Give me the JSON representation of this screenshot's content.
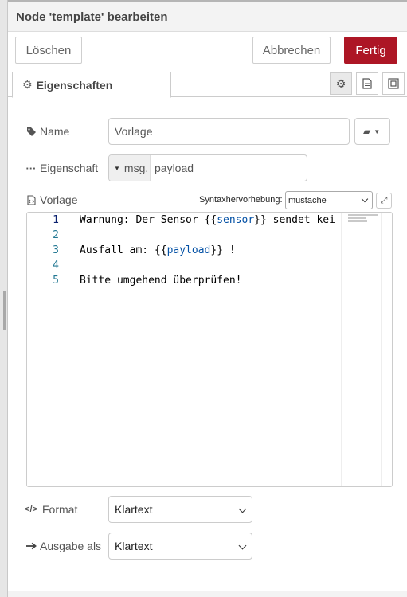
{
  "window": {
    "title": "Node 'template' bearbeiten"
  },
  "toolbar": {
    "delete_label": "Löschen",
    "cancel_label": "Abbrechen",
    "done_label": "Fertig"
  },
  "tabs": {
    "properties_label": "Eigenschaften"
  },
  "form": {
    "name": {
      "label": "Name",
      "value": "Vorlage"
    },
    "property": {
      "label": "Eigenschaft",
      "prefix": "msg.",
      "value": "payload"
    },
    "template": {
      "label": "Vorlage",
      "syntax_label": "Syntaxhervorhebung:",
      "syntax_value": "mustache",
      "lines": [
        {
          "no": "1",
          "text": "Warnung: Der Sensor {{sensor}} sendet kei"
        },
        {
          "no": "2",
          "text": ""
        },
        {
          "no": "3",
          "text": "Ausfall am: {{payload}} !"
        },
        {
          "no": "4",
          "text": ""
        },
        {
          "no": "5",
          "text": "Bitte umgehend überprüfen!"
        }
      ]
    },
    "format": {
      "label": "Format",
      "value": "Klartext"
    },
    "output": {
      "label": "Ausgabe als",
      "value": "Klartext"
    }
  },
  "icons": {
    "properties_tab": "gear-icon",
    "tab_buttons": [
      "gear-icon",
      "document-icon",
      "frame-icon"
    ],
    "name_label": "tag-icon",
    "name_button": "book-icon",
    "property_label": "ellipsis-icon",
    "template_label": "file-code-icon",
    "expand": "expand-icon",
    "format_label": "code-icon",
    "output_label": "arrow-right-icon"
  },
  "colors": {
    "primary_button": "#ad1625",
    "line_number": "#237893",
    "mustache_var": "#0451a5"
  }
}
